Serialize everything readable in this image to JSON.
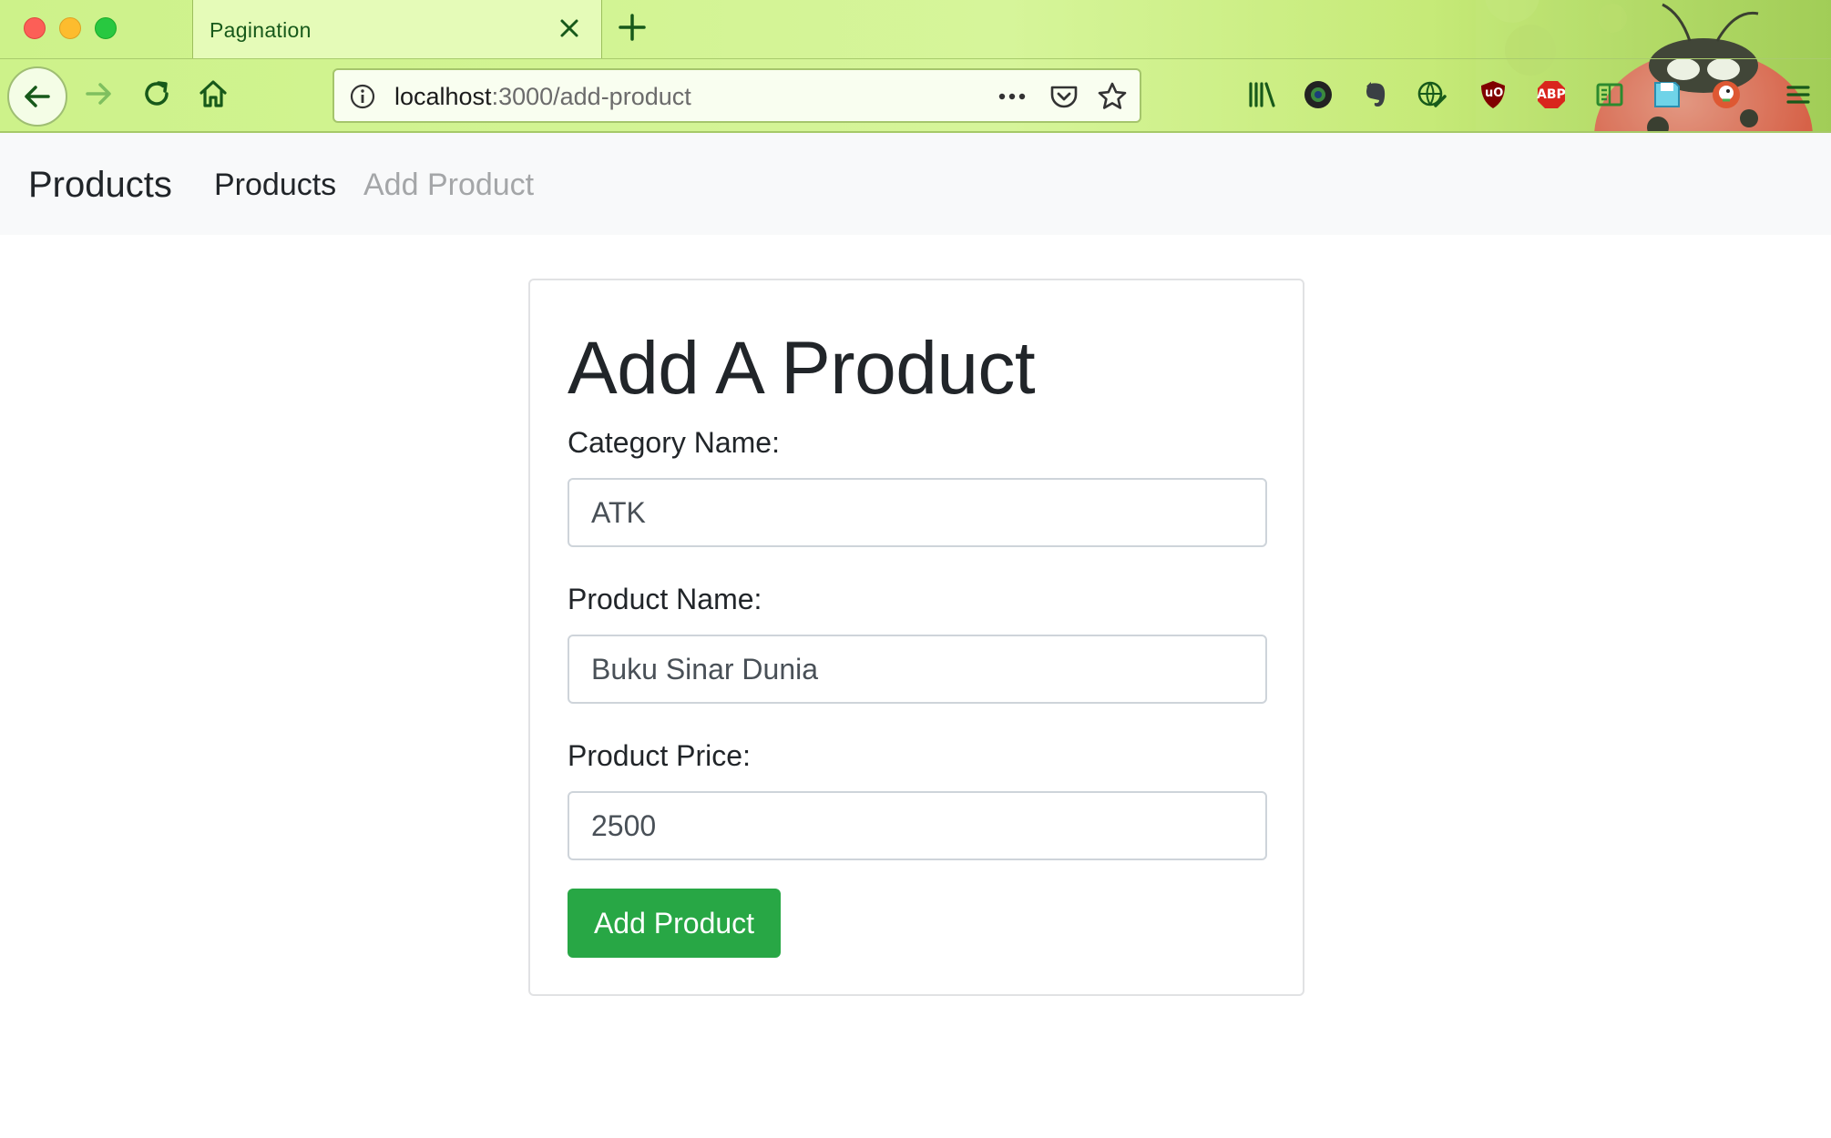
{
  "browser": {
    "tab_title": "Pagination",
    "url_host": "localhost",
    "url_path": ":3000/add-product",
    "accent_color": "#17591a",
    "extensions": [
      "library-icon",
      "camera-lens-icon",
      "evernote-icon",
      "globe-edit-icon",
      "ublock-icon",
      "adblock-plus-icon",
      "reader-icon",
      "save-icon",
      "duckduckgo-icon"
    ],
    "abp_label": "ABP",
    "ublock_label": "uO"
  },
  "navbar": {
    "brand": "Products",
    "links": [
      {
        "label": "Products",
        "active": true
      },
      {
        "label": "Add Product",
        "active": false
      }
    ]
  },
  "form": {
    "title": "Add A Product",
    "category_label": "Category Name:",
    "category_value": "ATK",
    "product_label": "Product Name:",
    "product_value": "Buku Sinar Dunia",
    "price_label": "Product Price:",
    "price_value": "2500",
    "submit_label": "Add Product",
    "submit_color": "#28a745"
  }
}
